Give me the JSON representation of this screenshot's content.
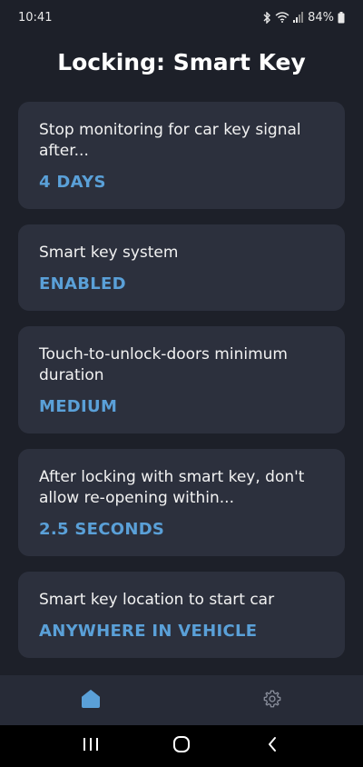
{
  "status_bar": {
    "time": "10:41",
    "battery": "84%",
    "icons": [
      "bluetooth-icon",
      "wifi-icon",
      "signal-icon",
      "battery-icon"
    ]
  },
  "page": {
    "title": "Locking: Smart Key"
  },
  "settings": [
    {
      "label": "Stop monitoring for car key signal after...",
      "value": "4 DAYS"
    },
    {
      "label": "Smart key system",
      "value": "ENABLED"
    },
    {
      "label": "Touch-to-unlock-doors minimum duration",
      "value": "MEDIUM"
    },
    {
      "label": "After locking with smart key, don't allow re-opening within...",
      "value": "2.5 SECONDS"
    },
    {
      "label": "Smart key location to start car",
      "value": "ANYWHERE IN VEHICLE"
    }
  ],
  "bottom_nav": {
    "items": [
      {
        "icon": "home-icon",
        "active": true
      },
      {
        "icon": "gear-icon",
        "active": false
      }
    ]
  },
  "system_nav": {
    "items": [
      "recents-icon",
      "home-circle-icon",
      "back-icon"
    ]
  },
  "colors": {
    "background": "#1d2029",
    "card": "#2c303d",
    "accent": "#5aa0d8",
    "nav_bar": "#272b37"
  }
}
